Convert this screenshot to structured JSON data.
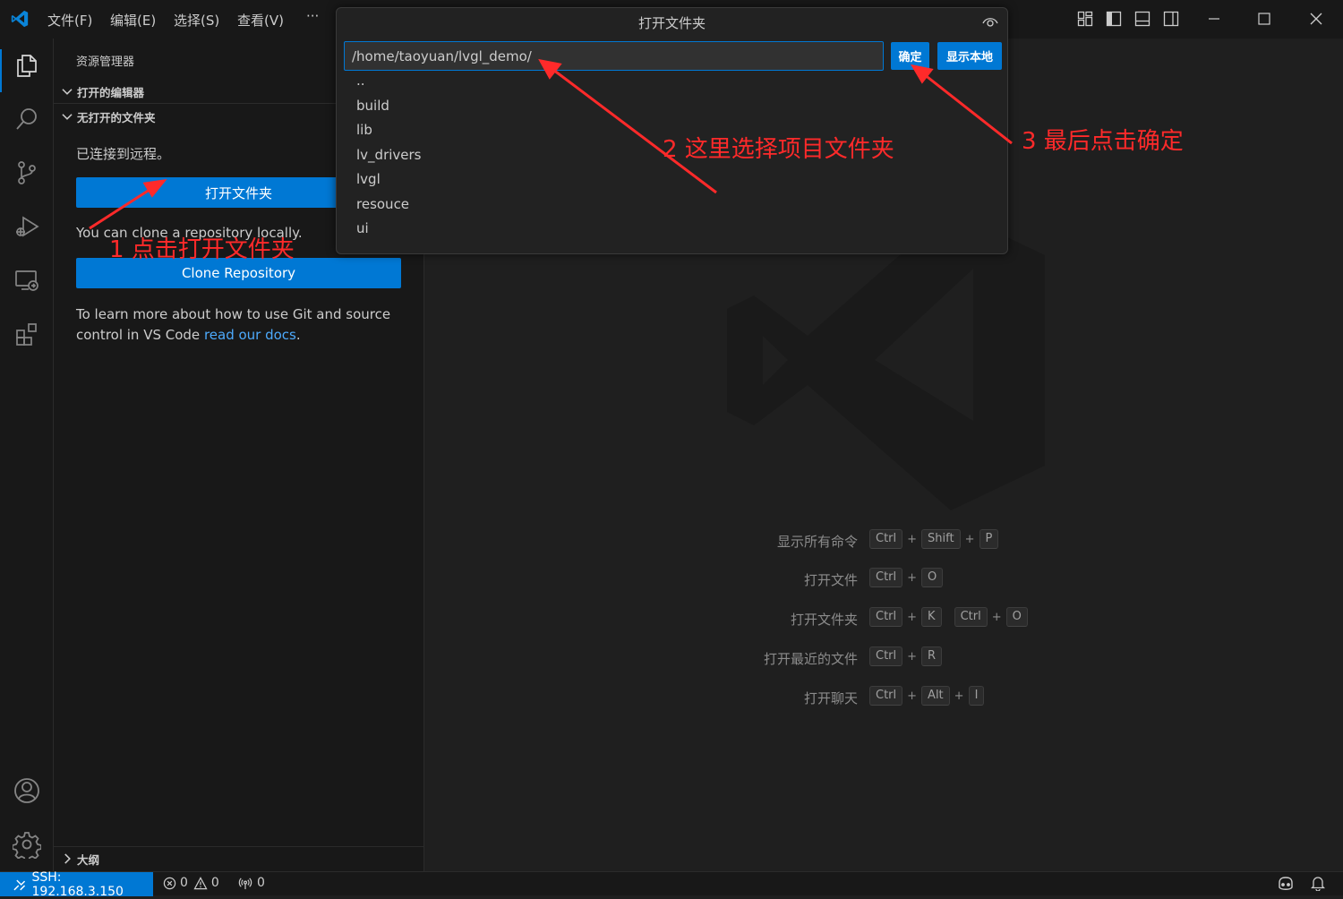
{
  "menu": {
    "file": "文件(F)",
    "edit": "编辑(E)",
    "selection": "选择(S)",
    "view": "查看(V)",
    "more": "···"
  },
  "sidebar": {
    "title": "资源管理器",
    "open_editors": "打开的编辑器",
    "no_folder": "无打开的文件夹",
    "connected": "已连接到远程。",
    "open_folder_btn": "打开文件夹",
    "clone_text": "You can clone a repository locally.",
    "clone_btn": "Clone Repository",
    "learn_line1": "To learn more about how to use Git and source",
    "learn_line2": "control in VS Code ",
    "learn_link": "read our docs",
    "learn_end": ".",
    "outline": "大纲"
  },
  "dialog": {
    "title": "打开文件夹",
    "path_value": "/home/taoyuan/lvgl_demo/",
    "ok_btn": "确定",
    "show_local_btn": "显示本地",
    "items": [
      "..",
      "build",
      "lib",
      "lv_drivers",
      "lvgl",
      "resouce",
      "ui"
    ]
  },
  "shortcuts": [
    {
      "label": "显示所有命令",
      "groups": [
        [
          "Ctrl",
          "Shift",
          "P"
        ]
      ]
    },
    {
      "label": "打开文件",
      "groups": [
        [
          "Ctrl",
          "O"
        ]
      ]
    },
    {
      "label": "打开文件夹",
      "groups": [
        [
          "Ctrl",
          "K"
        ],
        [
          "Ctrl",
          "O"
        ]
      ]
    },
    {
      "label": "打开最近的文件",
      "groups": [
        [
          "Ctrl",
          "R"
        ]
      ]
    },
    {
      "label": "打开聊天",
      "groups": [
        [
          "Ctrl",
          "Alt",
          "I"
        ]
      ]
    }
  ],
  "statusbar": {
    "remote": "SSH: 192.168.3.150",
    "errors": "0",
    "warnings": "0",
    "ports": "0"
  },
  "annotations": {
    "step1": "1 点击打开文件夹",
    "step2": "2 这里选择项目文件夹",
    "step3": "3 最后点击确定"
  },
  "colors": {
    "accent": "#0078d4",
    "annotation": "#ff2a2a",
    "background": "#1f1f1f",
    "sidebar": "#181818"
  },
  "icons": {
    "logo": "vscode-logo-icon",
    "explorer": "files-icon",
    "search": "search-icon",
    "scm": "source-control-icon",
    "debug": "run-debug-icon",
    "remote": "remote-explorer-icon",
    "extensions": "extensions-icon",
    "account": "account-icon",
    "settings": "gear-icon"
  }
}
